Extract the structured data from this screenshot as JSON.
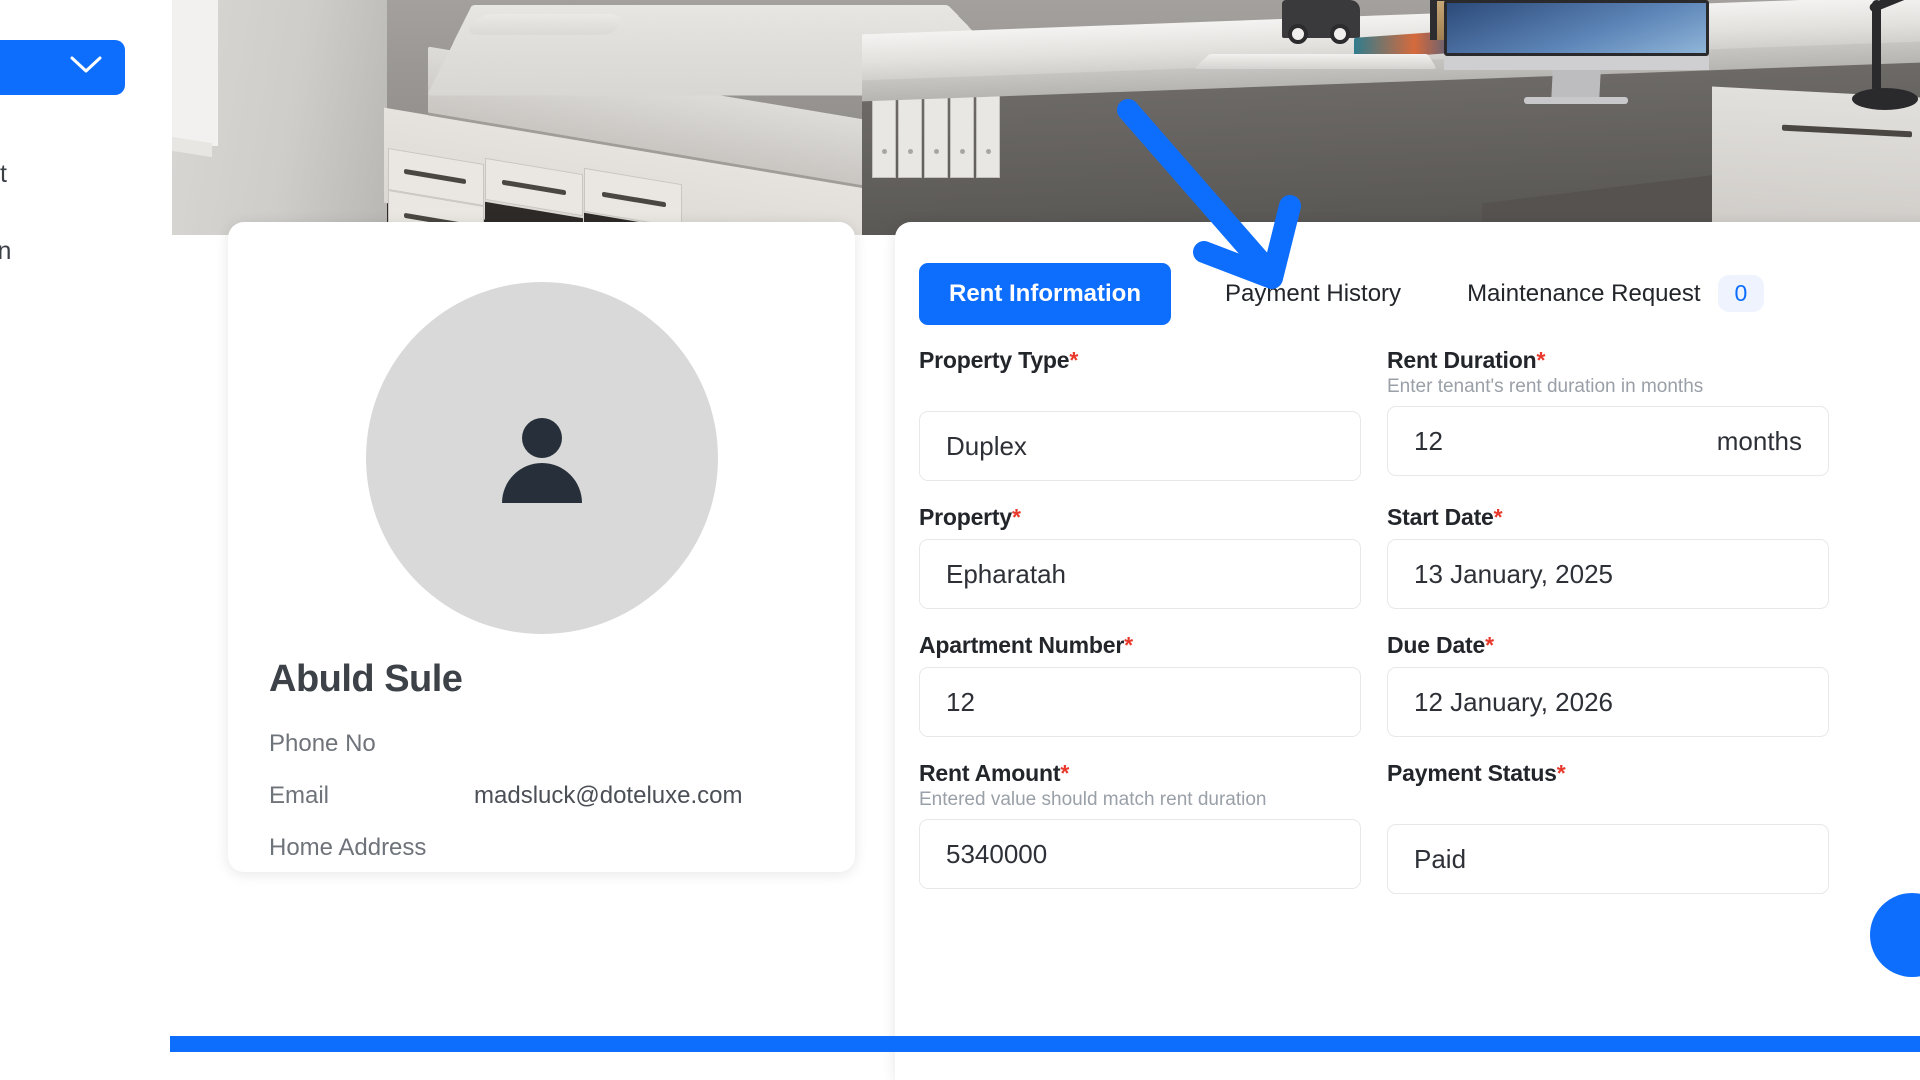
{
  "sidebar": {
    "dropdown": {
      "icon": "chevron-down-icon"
    },
    "items": [
      {
        "label": "ment"
      },
      {
        "label": "ation"
      }
    ]
  },
  "hero": {
    "alt": "bedroom-interior-photo"
  },
  "profile": {
    "avatar_icon": "person-avatar-icon",
    "name": "Abuld Sule",
    "rows": [
      {
        "label": "Phone No",
        "value": ""
      },
      {
        "label": "Email",
        "value": "madsluck@doteluxe.com"
      },
      {
        "label": "Home Address",
        "value": ""
      }
    ]
  },
  "tabs": [
    {
      "label": "Rent Information",
      "active": true
    },
    {
      "label": "Payment History",
      "active": false
    },
    {
      "label": "Maintenance Request",
      "active": false,
      "badge": "0"
    }
  ],
  "form": {
    "fields": [
      {
        "label": "Property Type",
        "required": "*",
        "hint": "",
        "value": "Duplex",
        "suffix": ""
      },
      {
        "label": "Rent Duration",
        "required": "*",
        "hint": "Enter tenant's rent duration in months",
        "value": "12",
        "suffix": "months"
      },
      {
        "label": "Property",
        "required": "*",
        "hint": "",
        "value": "Epharatah",
        "suffix": ""
      },
      {
        "label": "Start Date",
        "required": "*",
        "hint": "",
        "value": "13 January, 2025",
        "suffix": ""
      },
      {
        "label": "Apartment Number",
        "required": "*",
        "hint": "",
        "value": "12",
        "suffix": ""
      },
      {
        "label": "Due Date",
        "required": "*",
        "hint": "",
        "value": "12 January, 2026",
        "suffix": ""
      },
      {
        "label": "Rent Amount",
        "required": "*",
        "hint": "Entered value should match rent duration",
        "value": "5340000",
        "suffix": ""
      },
      {
        "label": "Payment Status",
        "required": "*",
        "hint": "",
        "value": "Paid",
        "suffix": ""
      }
    ]
  },
  "fab": {
    "icon": "action-button-icon"
  },
  "annotation": {
    "arrow": "blue-pointer-arrow",
    "target": "Payment History"
  },
  "colors": {
    "accent": "#0d6efd",
    "required": "#e8392c",
    "badge_bg": "#eef3fe",
    "text": "#22252a",
    "muted": "#9aa0a8",
    "avatar_bg": "#d9d9d9"
  }
}
